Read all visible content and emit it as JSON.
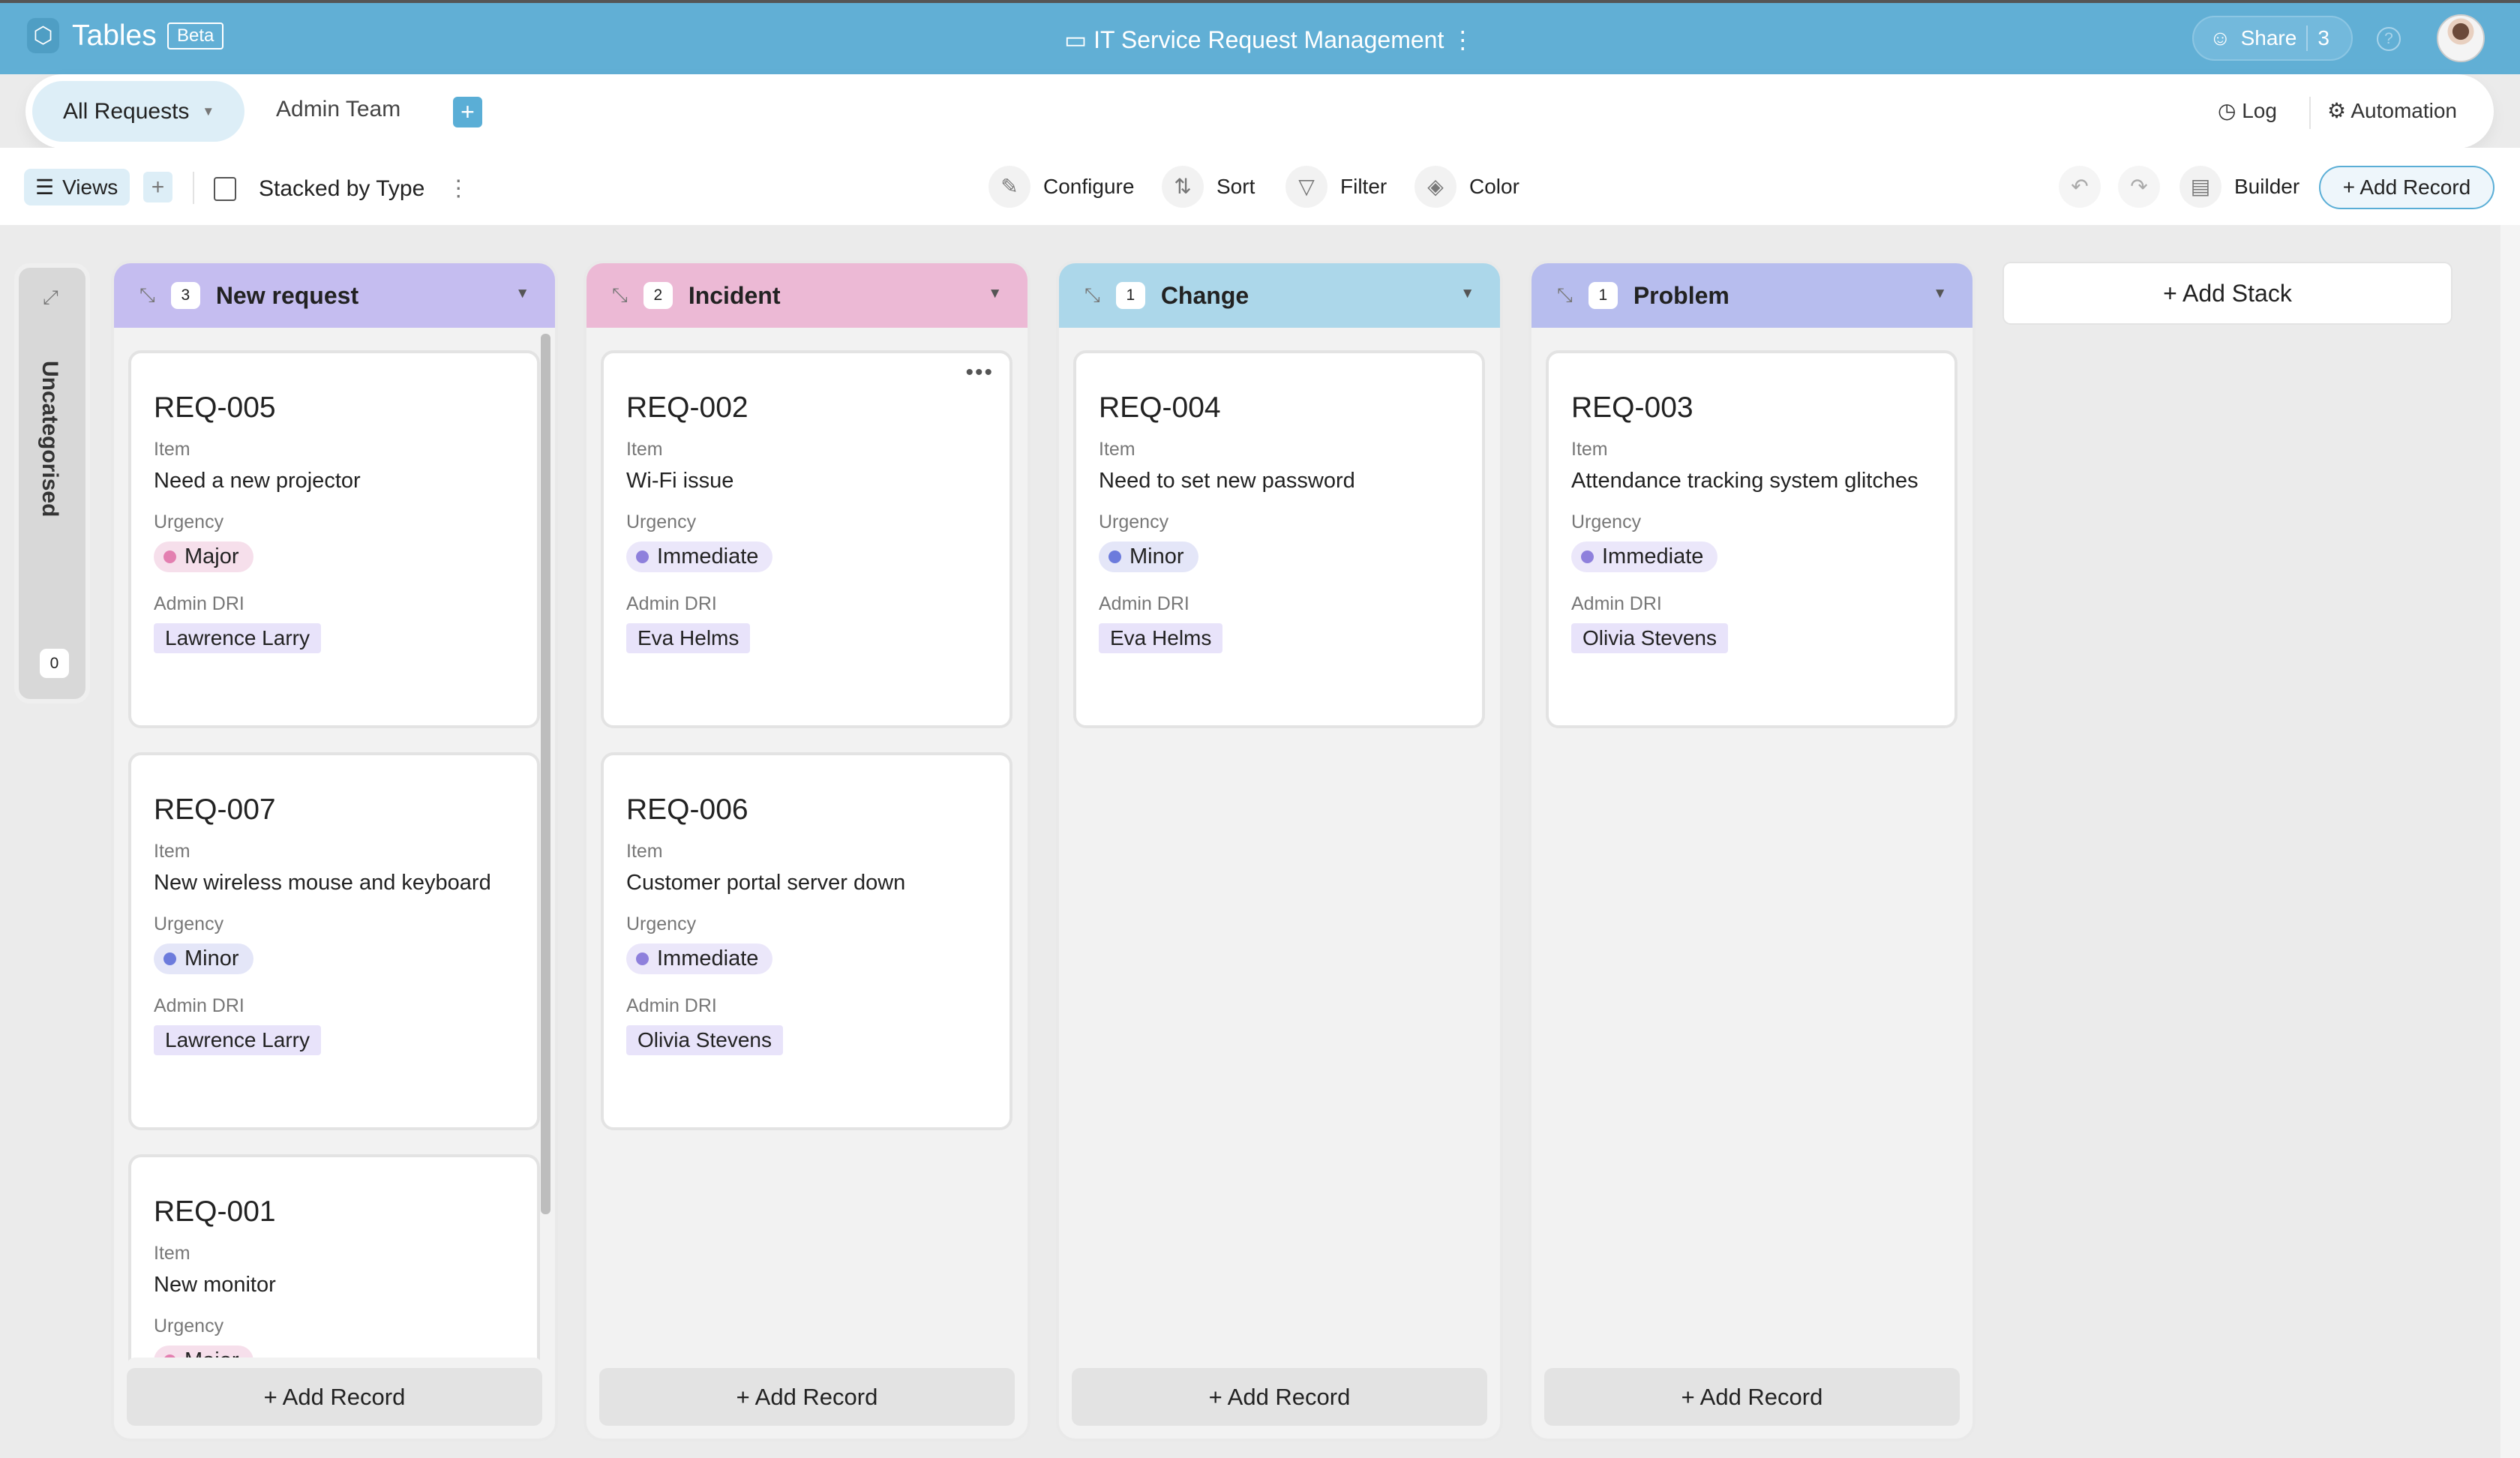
{
  "header": {
    "app_title": "Tables",
    "badge": "Beta",
    "doc_title": "IT Service Request Management",
    "share_label": "Share",
    "share_count": "3"
  },
  "tabs": {
    "active": "All Requests",
    "second": "Admin Team",
    "log": "Log",
    "automation": "Automation"
  },
  "toolbar": {
    "views": "Views",
    "view_name": "Stacked by Type",
    "configure": "Configure",
    "sort": "Sort",
    "filter": "Filter",
    "color": "Color",
    "builder": "Builder",
    "add_record": "+ Add Record"
  },
  "uncategorised": {
    "label": "Uncategorised",
    "count": "0"
  },
  "add_stack": "+ Add Stack",
  "add_record_label": "+ Add Record",
  "field_labels": {
    "item": "Item",
    "urgency": "Urgency",
    "admin": "Admin DRI"
  },
  "colors": {
    "new_request": "#c5bdf0",
    "incident": "#ecb9d5",
    "change": "#acd7ea",
    "problem": "#b7bdee",
    "major": "#e37fb0",
    "immediate": "#8e80dc",
    "minor": "#6c7bdc"
  },
  "columns": [
    {
      "title": "New request",
      "count": "3",
      "cards": [
        {
          "id": "REQ-005",
          "item": "Need a new projector",
          "urgency": "Major",
          "admin": "Lawrence Larry"
        },
        {
          "id": "REQ-007",
          "item": "New wireless mouse and keyboard",
          "urgency": "Minor",
          "admin": "Lawrence Larry"
        },
        {
          "id": "REQ-001",
          "item": "New monitor",
          "urgency": "Major",
          "admin": ""
        }
      ]
    },
    {
      "title": "Incident",
      "count": "2",
      "cards": [
        {
          "id": "REQ-002",
          "item": "Wi-Fi issue",
          "urgency": "Immediate",
          "admin": "Eva Helms"
        },
        {
          "id": "REQ-006",
          "item": "Customer portal server down",
          "urgency": "Immediate",
          "admin": "Olivia Stevens"
        }
      ]
    },
    {
      "title": "Change",
      "count": "1",
      "cards": [
        {
          "id": "REQ-004",
          "item": "Need to set new password",
          "urgency": "Minor",
          "admin": "Eva Helms"
        }
      ]
    },
    {
      "title": "Problem",
      "count": "1",
      "cards": [
        {
          "id": "REQ-003",
          "item": "Attendance tracking system glitches",
          "urgency": "Immediate",
          "admin": "Olivia Stevens"
        }
      ]
    }
  ]
}
